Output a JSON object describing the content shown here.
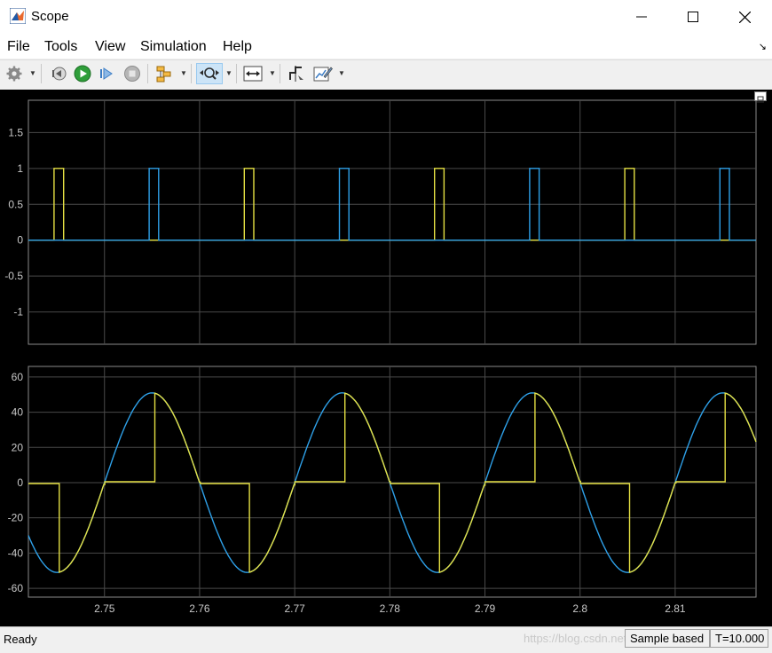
{
  "window": {
    "title": "Scope",
    "accent_color": "#0078d7"
  },
  "menu": {
    "items": [
      {
        "id": "file",
        "label": "File"
      },
      {
        "id": "tools",
        "label": "Tools"
      },
      {
        "id": "view",
        "label": "View"
      },
      {
        "id": "simulation",
        "label": "Simulation"
      },
      {
        "id": "help",
        "label": "Help"
      }
    ],
    "dock_arrow": "↘"
  },
  "toolbar": {
    "icons": [
      "gear-icon",
      "step-back-icon",
      "run-icon",
      "step-forward-icon",
      "stop-icon",
      "signal-selector-icon",
      "zoom-icon",
      "fit-axes-icon",
      "cursor-measurement-icon",
      "style-icon"
    ]
  },
  "status": {
    "ready": "Ready",
    "watermark": "https://blog.csdn.net/...",
    "mode": "Sample based",
    "time": "T=10.000"
  },
  "chart_data": [
    {
      "type": "line",
      "background": "#000000",
      "grid": true,
      "xlim": [
        2.742,
        2.8185
      ],
      "ylim": [
        -1.45,
        1.95
      ],
      "yticks": [
        "1.5",
        "1",
        "0.5",
        "0",
        "-0.5",
        "-1"
      ],
      "ytick_values": [
        1.5,
        1,
        0.5,
        0,
        -0.5,
        -1
      ],
      "series": [
        {
          "color": "#e5e043",
          "pulse_starts": [
            2.7447,
            2.7647,
            2.7847,
            2.8047
          ],
          "pulse_width": 0.001,
          "high": 1,
          "low": 0
        },
        {
          "color": "#2ea0e8",
          "pulse_starts": [
            2.7547,
            2.7747,
            2.7947,
            2.8147
          ],
          "pulse_width": 0.001,
          "high": 1,
          "low": 0
        }
      ]
    },
    {
      "type": "line",
      "background": "#000000",
      "grid": true,
      "xlim": [
        2.742,
        2.8185
      ],
      "ylim": [
        -65,
        66
      ],
      "yticks": [
        "60",
        "40",
        "20",
        "0",
        "-20",
        "-40",
        "-60"
      ],
      "ytick_values": [
        60,
        40,
        20,
        0,
        -20,
        -40,
        -60
      ],
      "xticks": [
        "2.75",
        "2.76",
        "2.77",
        "2.78",
        "2.79",
        "2.8",
        "2.81"
      ],
      "xtick_values": [
        2.75,
        2.76,
        2.77,
        2.78,
        2.79,
        2.8,
        2.81
      ],
      "series": [
        {
          "color": "#2ea0e8",
          "kind": "sine",
          "amplitude": 51,
          "period": 0.02,
          "zero_crossing": 2.75
        },
        {
          "color": "#e5e043",
          "kind": "controlled-sine",
          "amplitude": 51,
          "period": 0.02,
          "zero_crossing": 2.75,
          "fire_delay": 0.0052,
          "off_level": 1
        }
      ]
    }
  ]
}
